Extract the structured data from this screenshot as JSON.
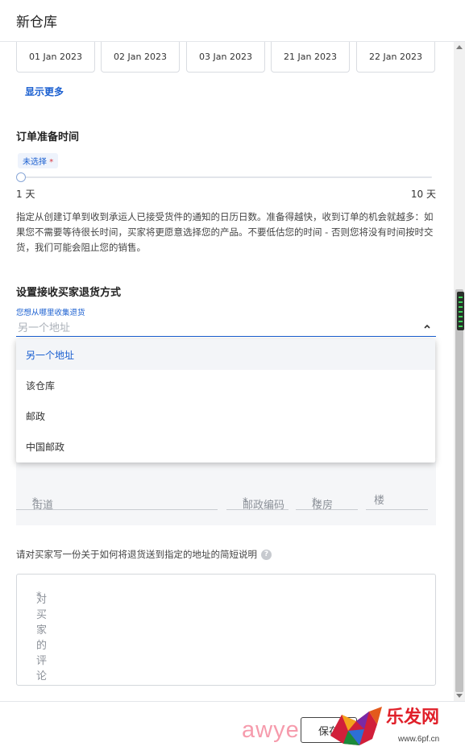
{
  "header": {
    "title": "新仓库"
  },
  "dates": [
    "01 Jan 2023",
    "02 Jan 2023",
    "03 Jan 2023",
    "21 Jan 2023",
    "22 Jan 2023"
  ],
  "show_more": "显示更多",
  "prep": {
    "title": "订单准备时间",
    "badge": "未选择",
    "required_mark": "*",
    "min_label": "1 天",
    "max_label": "10 天",
    "value": 0,
    "description": "指定从创建订单到收到承运人已接受货件的通知的日历日数。准备得越快，收到订单的机会就越多：如果您不需要等待很长时间，买家将更愿意选择您的产品。不要低估您的时间 - 否则您将没有时间按时交货，我们可能会阻止您的销售。"
  },
  "returns": {
    "title": "设置接收买家退货方式",
    "field_label": "您想从哪里收集退货",
    "selected": "另一个地址",
    "options": [
      "另一个地址",
      "该仓库",
      "邮政",
      "中国邮政"
    ]
  },
  "address": {
    "street": "街道",
    "postcode": "邮政编码",
    "building": "楼房",
    "floor": "楼"
  },
  "instructions": {
    "label": "请对买家写一份关于如何将退货送到指定的地址的简短说明",
    "help": "?",
    "placeholder": "对买家的评论"
  },
  "footer": {
    "button_label": "保存"
  },
  "watermark": {
    "text": "awye",
    "brand": "乐发网",
    "url": "www.6pf.cn"
  },
  "colors": {
    "accent": "#1a5fd0",
    "required": "#d9363e"
  }
}
